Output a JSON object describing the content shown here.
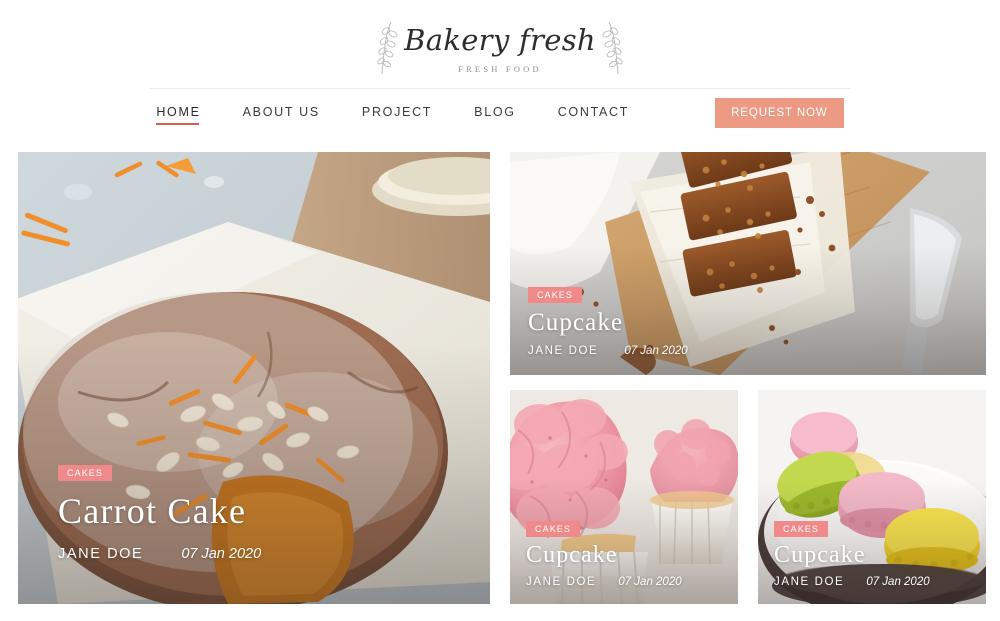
{
  "header": {
    "logo_script": "Bakery fresh",
    "logo_subtitle": "FRESH FOOD",
    "logo_sprig_left": "leaf-sprig-icon",
    "logo_sprig_right": "leaf-sprig-icon"
  },
  "nav": {
    "items": [
      {
        "label": "HOME",
        "active": true
      },
      {
        "label": "ABOUT US",
        "active": false
      },
      {
        "label": "PROJECT",
        "active": false
      },
      {
        "label": "BLOG",
        "active": false
      },
      {
        "label": "CONTACT",
        "active": false
      }
    ],
    "cta_label": "REQUEST NOW",
    "cta_color": "#ec9a84",
    "active_underline_color": "#d35f52"
  },
  "colors": {
    "badge": "#f08a8a",
    "accent": "#ec9a84",
    "text_dark": "#3b3b3b",
    "page_background": "#ffffff",
    "divider": "#ececec"
  },
  "cards": [
    {
      "id": "hero",
      "badge": "CAKES",
      "title": "Carrot Cake",
      "author": "JANE DOE",
      "date": "07 Jan 2020",
      "image_alt": "carrot-cake-with-powdered-sugar-and-almond-flakes"
    },
    {
      "id": "top-right",
      "badge": "CAKES",
      "title": "Cupcake",
      "author": "JANE DOE",
      "date": "07 Jan 2020",
      "image_alt": "granola-bars-on-parchment-with-knife"
    },
    {
      "id": "bottom-left",
      "badge": "CAKES",
      "title": "Cupcake",
      "author": "JANE DOE",
      "date": "07 Jan 2020",
      "image_alt": "pink-frosted-cupcakes"
    },
    {
      "id": "bottom-right",
      "badge": "CAKES",
      "title": "Cupcake",
      "author": "JANE DOE",
      "date": "07 Jan 2020",
      "image_alt": "colorful-macarons-on-white-dish"
    }
  ]
}
